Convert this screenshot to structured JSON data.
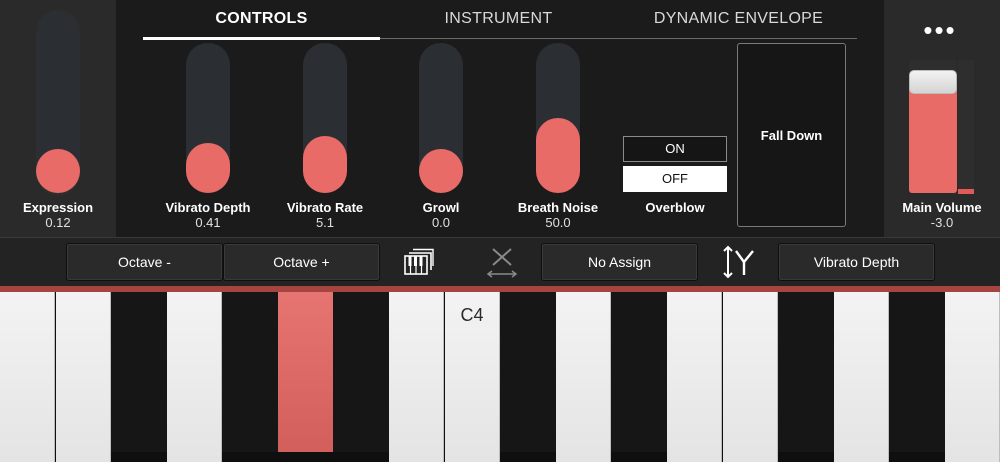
{
  "tabs": [
    {
      "label": "CONTROLS",
      "active": true
    },
    {
      "label": "INSTRUMENT",
      "active": false
    },
    {
      "label": "DYNAMIC ENVELOPE",
      "active": false
    }
  ],
  "sliders": {
    "expression": {
      "label": "Expression",
      "value": "0.12",
      "level": 0.12
    },
    "vibrato_depth": {
      "label": "Vibrato Depth",
      "value": "0.41",
      "level": 0.41
    },
    "vibrato_rate": {
      "label": "Vibrato Rate",
      "value": "5.1",
      "level": 0.51
    },
    "growl": {
      "label": "Growl",
      "value": "0.0",
      "level": 0.0
    },
    "breath_noise": {
      "label": "Breath Noise",
      "value": "50.0",
      "level": 0.5
    }
  },
  "overblow": {
    "label": "Overblow",
    "on_label": "ON",
    "off_label": "OFF",
    "selected": "OFF"
  },
  "envelope": {
    "label": "Fall Down"
  },
  "menu": {
    "dots": "•••"
  },
  "main_volume": {
    "label": "Main Volume",
    "value": "-3.0",
    "level": 0.82
  },
  "assign_bar": {
    "octave_minus": "Octave -",
    "octave_plus": "Octave +",
    "x_assign": "No Assign",
    "y_assign": "Vibrato Depth"
  },
  "keyboard": {
    "c4_label": "C4",
    "pressed_key": "black-key-5"
  },
  "colors": {
    "accent": "#e96b68",
    "background": "#1b1b1b",
    "panel": "#2a2a2a"
  }
}
